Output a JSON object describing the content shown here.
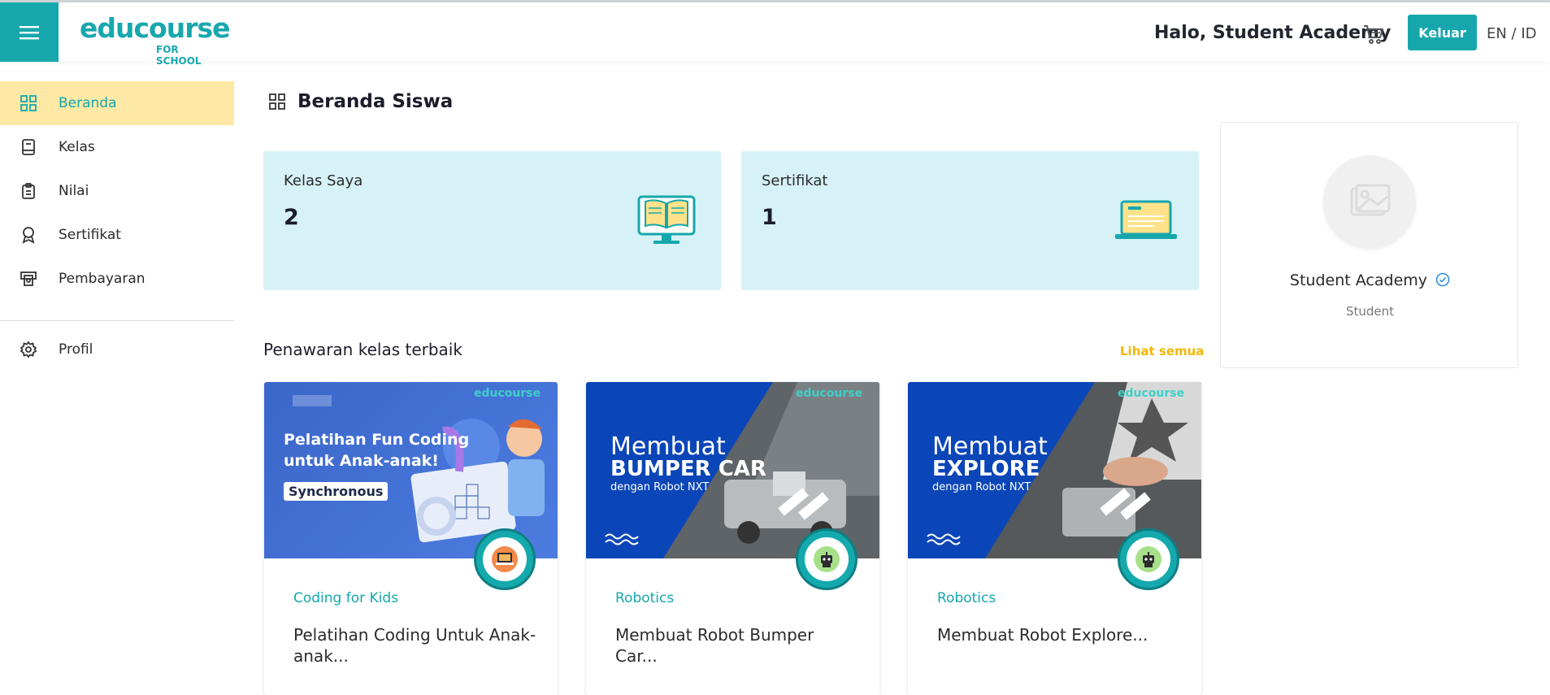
{
  "header": {
    "logo_text": "educourse",
    "logo_sub": "FOR SCHOOL",
    "greeting": "Halo, Student Academy",
    "logout_label": "Keluar",
    "language": "EN / ID"
  },
  "sidebar": {
    "items": [
      {
        "label": "Beranda",
        "icon": "grid-icon",
        "active": true
      },
      {
        "label": "Kelas",
        "icon": "book-icon"
      },
      {
        "label": "Nilai",
        "icon": "clipboard-icon"
      },
      {
        "label": "Sertifikat",
        "icon": "award-icon"
      },
      {
        "label": "Pembayaran",
        "icon": "payment-icon"
      }
    ],
    "profile_label": "Profil"
  },
  "main": {
    "title": "Beranda Siswa",
    "stats": [
      {
        "label": "Kelas Saya",
        "value": "2"
      },
      {
        "label": "Sertifikat",
        "value": "1"
      }
    ],
    "offers_title": "Penawaran kelas terbaik",
    "see_all": "Lihat semua",
    "courses": [
      {
        "category": "Coding for Kids",
        "title": "Pelatihan Coding Untuk Anak-anak...",
        "banner_line1": "Pelatihan Fun Coding",
        "banner_line2": "untuk Anak-anak!",
        "banner_tag": "Synchronous",
        "banner_logo": "educourse"
      },
      {
        "category": "Robotics",
        "title": "Membuat Robot Bumper Car...",
        "banner_line1": "Membuat",
        "banner_line2": "BUMPER CAR",
        "banner_line3": "dengan Robot NXT",
        "banner_logo": "educourse"
      },
      {
        "category": "Robotics",
        "title": "Membuat Robot Explore...",
        "banner_line1": "Membuat",
        "banner_line2": "EXPLORE",
        "banner_line3": "dengan Robot NXT",
        "banner_logo": "educourse"
      }
    ]
  },
  "profile": {
    "name": "Student Academy",
    "role": "Student"
  },
  "colors": {
    "brand": "#16a7ad",
    "active_bg": "#fde8a6",
    "stat_bg": "#d6f2f7",
    "accent_link": "#f2b705"
  }
}
